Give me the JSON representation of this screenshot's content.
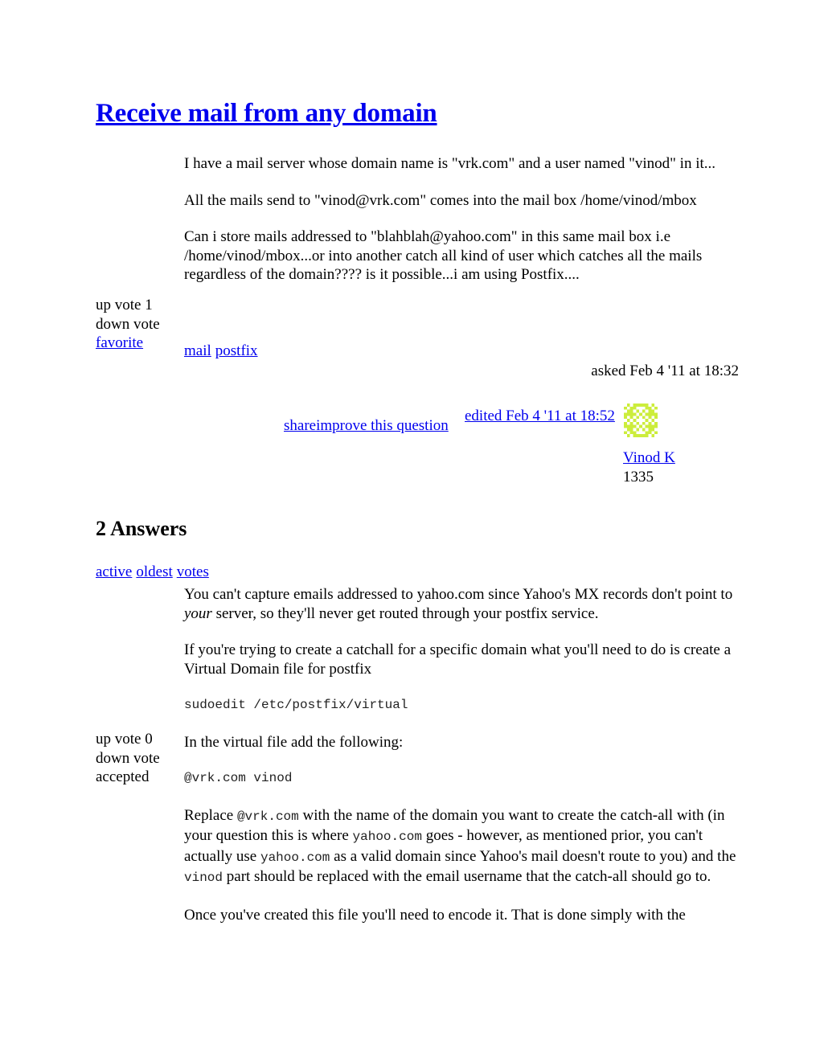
{
  "question": {
    "title": "Receive mail from any domain",
    "votes": {
      "up_label": "up vote 1",
      "down_label": "down vote",
      "favorite_label": "favorite"
    },
    "body": {
      "p1": "I have a mail server whose domain name is \"vrk.com\" and a user named \"vinod\" in it...",
      "p2": "All the mails send to \"vinod@vrk.com\" comes into the mail box /home/vinod/mbox",
      "p3": "Can i store mails addressed to \"blahblah@yahoo.com\" in this same mail box i.e /home/vinod/mbox...or into another catch all kind of user which catches all the mails regardless of the domain???? is it possible...i am using Postfix...."
    },
    "tags": [
      "mail",
      "postfix"
    ],
    "asked": "asked Feb 4 '11 at 18:32",
    "share_label": "shareimprove this question",
    "edited": "edited Feb 4 '11 at 18:52",
    "owner": {
      "name": "Vinod K",
      "reputation": "1335",
      "avatar_color": "#cced3c"
    }
  },
  "answers_section": {
    "heading": "2 Answers",
    "sort_tabs": [
      "active",
      "oldest",
      "votes"
    ]
  },
  "answer": {
    "votes": {
      "up_label": "up vote 0",
      "down_label": "down vote",
      "accepted_label": "accepted"
    },
    "p1_before": "You can't capture emails addressed to yahoo.com since Yahoo's MX records don't point to ",
    "p1_em": "your",
    "p1_after": " server, so they'll never get routed through your postfix service.",
    "p2": "If you're trying to create a catchall for a specific domain what you'll need to do is create a Virtual Domain file for postfix",
    "code1": "sudoedit /etc/postfix/virtual",
    "p3": "In the virtual file add the following:",
    "code2": "@vrk.com vinod",
    "p4_part1": "Replace ",
    "p4_code1": "@vrk.com",
    "p4_part2": " with the name of the domain you want to create the catch-all with (in your question this is where ",
    "p4_code2": "yahoo.com",
    "p4_part3": " goes - however, as mentioned prior, you can't actually use ",
    "p4_code3": "yahoo.com",
    "p4_part4": " as a valid domain since Yahoo's mail doesn't route to you) and the ",
    "p4_code4": "vinod",
    "p4_part5": " part should be replaced with the email username that the catch-all should go to.",
    "p5": "Once you've created this file you'll need to encode it. That is done simply with the"
  },
  "theme": {
    "link_color": "#0000ee",
    "text_color": "#000000",
    "background": "#ffffff"
  }
}
